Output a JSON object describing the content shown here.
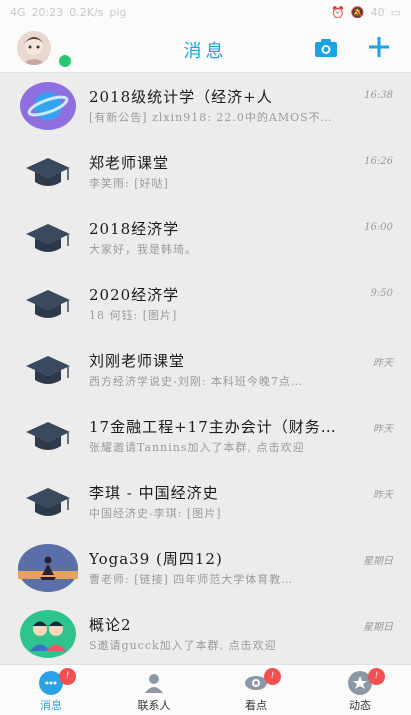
{
  "status_bar": {
    "network": "4G",
    "time": "20:23",
    "speed": "0.2K/s",
    "app": "pig",
    "battery": "40"
  },
  "header": {
    "title": "消息",
    "accent_color": "#1ea2e0",
    "icons": [
      "camera-icon",
      "plus-icon"
    ]
  },
  "conversations": [
    {
      "name": "2018级统计学（经济+人",
      "time": "16:38",
      "preview": "[有新公告] zlxin918: 22.0中的AMOS不…",
      "avatar": "planet-icon"
    },
    {
      "name": "郑老师课堂",
      "time": "16:26",
      "preview": "李笑雨: [好哒]",
      "avatar": "graduation-cap-icon"
    },
    {
      "name": "2018经济学",
      "time": "16:00",
      "preview": "大家好，我是韩琦。",
      "avatar": "graduation-cap-icon"
    },
    {
      "name": "2020经济学",
      "time": "9:50",
      "preview": "18 何钰: [图片]",
      "avatar": "graduation-cap-icon"
    },
    {
      "name": "刘刚老师课堂",
      "time": "昨天",
      "preview": "西方经济学说史-刘刚: 本科班今晚7点…",
      "avatar": "graduation-cap-icon"
    },
    {
      "name": "17金融工程+17主办会计（财务…",
      "time": "昨天",
      "preview": "张耀邀请Tannins加入了本群, 点击欢迎",
      "avatar": "graduation-cap-icon"
    },
    {
      "name": "李琪 - 中国经济史",
      "time": "昨天",
      "preview": "中国经济史-李琪: [图片]",
      "avatar": "graduation-cap-icon"
    },
    {
      "name": "Yoga39 (周四12)",
      "time": "星期日",
      "preview": "曹老师: [链接] 四年师范大学体育教…",
      "avatar": "yoga-photo"
    },
    {
      "name": "概论2",
      "time": "星期日",
      "preview": "S邀请gucck加入了本群, 点击欢迎",
      "avatar": "couple-icon"
    }
  ],
  "tabs": [
    {
      "label": "消息",
      "badge": "!",
      "icon": "chat-icon",
      "active": true
    },
    {
      "label": "联系人",
      "badge": "",
      "icon": "contacts-icon",
      "active": false
    },
    {
      "label": "看点",
      "badge": "!",
      "icon": "eye-icon",
      "active": false
    },
    {
      "label": "动态",
      "badge": "!",
      "icon": "star-icon",
      "active": false
    }
  ]
}
